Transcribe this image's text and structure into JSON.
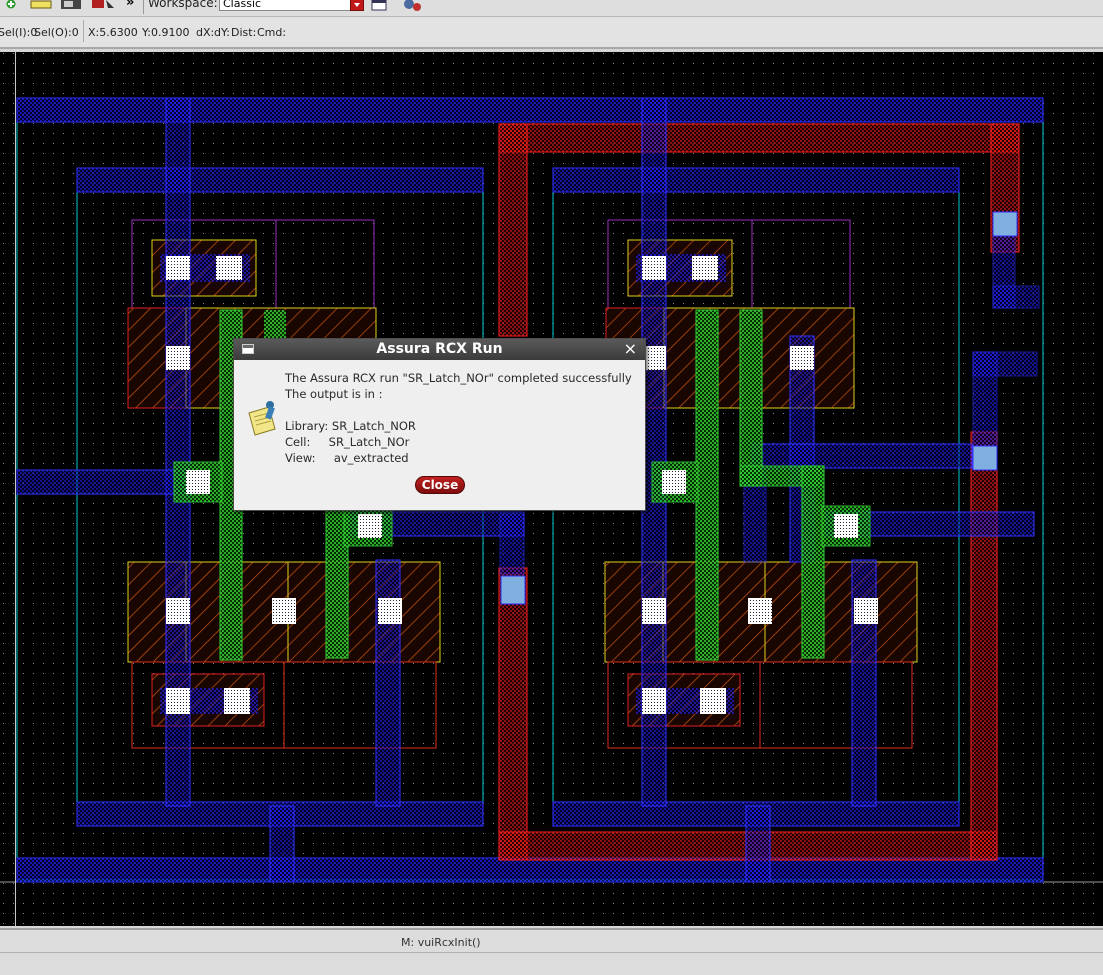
{
  "toolbar": {
    "workspace_label": "Workspace:",
    "workspace_value": "Classic",
    "icons": [
      "add-icon",
      "ruler-icon",
      "display-icon",
      "pointer-icon",
      "more-icon",
      "window-icon",
      "settings-icon"
    ]
  },
  "status": {
    "sel_i": "Sel(I):0",
    "sel_o": "Sel(O):0",
    "x": "X:5.6300",
    "y": "Y:0.9100",
    "dx": "dX:",
    "dy": "dY:",
    "dist": "Dist:",
    "cmd": "Cmd:"
  },
  "dialog": {
    "title": "Assura RCX Run",
    "line1": "The Assura RCX run \"SR_Latch_NOr\" completed successfully",
    "line2": "The output is in :",
    "library": "Library: SR_Latch_NOR",
    "cell": "Cell:     SR_Latch_NOr",
    "view": "View:     av_extracted",
    "close_label": "Close",
    "icon": "notepad-pencil-icon"
  },
  "bottom": {
    "command": "M: vuiRcxInit()"
  },
  "colors": {
    "metal1": "#2a2aff",
    "poly": "#e02020",
    "green": "#33cc33",
    "nwell": "#00c8d0",
    "active": "#e0d020",
    "implant": "#9a30c0"
  }
}
